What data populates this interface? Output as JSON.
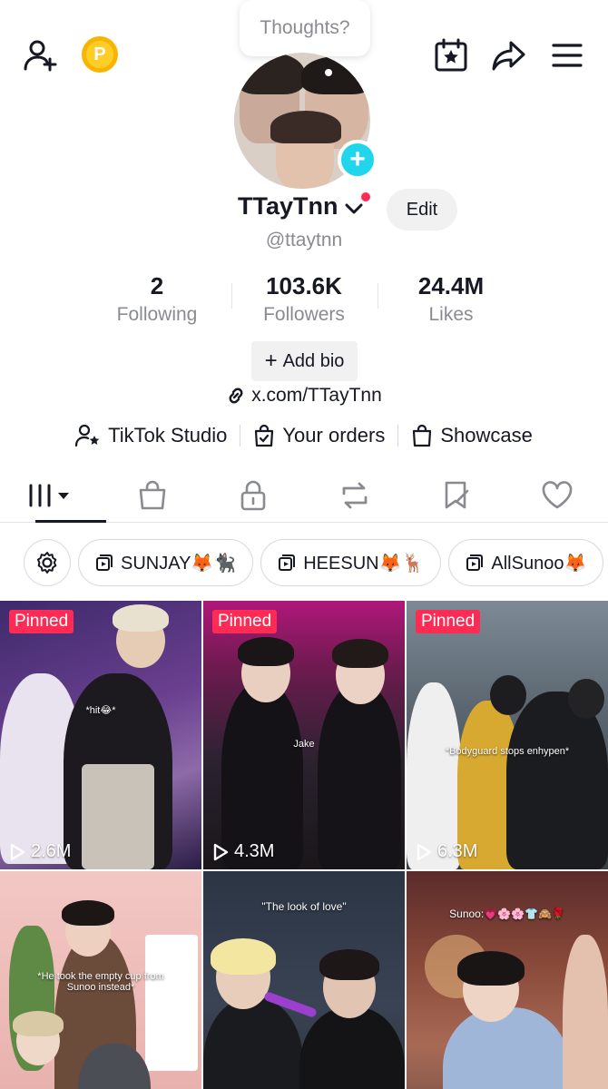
{
  "top_bar": {
    "thought_bubble": "Thoughts?",
    "coin_letter": "P"
  },
  "profile": {
    "display_name": "TTayTnn",
    "edit_label": "Edit",
    "username": "@ttaytnn",
    "stats": [
      {
        "value": "2",
        "label": "Following"
      },
      {
        "value": "103.6K",
        "label": "Followers"
      },
      {
        "value": "24.4M",
        "label": "Likes"
      }
    ],
    "add_bio_label": "Add bio",
    "link": "x.com/TTayTnn",
    "tools": [
      {
        "label": "TikTok Studio",
        "icon": "person-star-icon"
      },
      {
        "label": "Your orders",
        "icon": "bag-check-icon"
      },
      {
        "label": "Showcase",
        "icon": "shopping-bag-icon"
      }
    ]
  },
  "tabs": [
    {
      "name": "videos",
      "icon": "grid-icon",
      "active": true
    },
    {
      "name": "shop",
      "icon": "bag-icon",
      "active": false
    },
    {
      "name": "private",
      "icon": "lock-icon",
      "active": false
    },
    {
      "name": "reposts",
      "icon": "repost-icon",
      "active": false
    },
    {
      "name": "favorites",
      "icon": "bookmark-icon",
      "active": false
    },
    {
      "name": "liked",
      "icon": "heart-icon",
      "active": false
    }
  ],
  "playlists": [
    {
      "label": "SUNJAY🦊🐈‍⬛"
    },
    {
      "label": "HEESUN🦊🦌"
    },
    {
      "label": "AllSunoo🦊"
    }
  ],
  "videos": [
    {
      "pinned": "Pinned",
      "views": "2.6M",
      "caption": "*hit😂*"
    },
    {
      "pinned": "Pinned",
      "views": "4.3M",
      "caption": "Jake"
    },
    {
      "pinned": "Pinned",
      "views": "6.3M",
      "caption": "*Bodyguard stops enhypen*"
    },
    {
      "pinned": "",
      "views": "",
      "caption": "*He took the empty cup from Sunoo instead*"
    },
    {
      "pinned": "",
      "views": "",
      "caption": "\"The look of love\""
    },
    {
      "pinned": "",
      "views": "",
      "caption": "Sunoo:💗🌸🌸👕🙈🌹"
    }
  ],
  "colors": {
    "accent_red": "#fe2c55",
    "accent_cyan": "#20d5ec",
    "coin": "#f7b500",
    "text_secondary": "#8a8b91"
  }
}
